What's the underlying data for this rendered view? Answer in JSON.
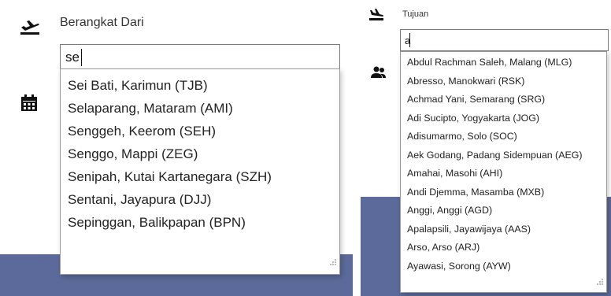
{
  "left": {
    "label": "Berangkat Dari",
    "input_value": "se",
    "icons": [
      "plane-departure-icon",
      "calendar-icon"
    ],
    "suggestions": [
      "Sei Bati, Karimun (TJB)",
      "Selaparang, Mataram (AMI)",
      "Senggeh, Keerom (SEH)",
      "Senggo, Mappi (ZEG)",
      "Senipah, Kutai Kartanegara (SZH)",
      "Sentani, Jayapura (DJJ)",
      "Sepinggan, Balikpapan (BPN)"
    ]
  },
  "right": {
    "label": "Tujuan",
    "input_value": "a",
    "icons": [
      "plane-arrival-icon",
      "users-icon"
    ],
    "suggestions": [
      "Abdul Rachman Saleh, Malang (MLG)",
      "Abresso, Manokwari (RSK)",
      "Achmad Yani, Semarang (SRG)",
      "Adi Sucipto, Yogyakarta (JOG)",
      "Adisumarmo, Solo (SOC)",
      "Aek Godang, Padang Sidempuan (AEG)",
      "Amahai, Masohi (AHI)",
      "Andi Djemma, Masamba (MXB)",
      "Anggi, Anggi (AGD)",
      "Apalapsili, Jayawijaya (AAS)",
      "Arso, Arso (ARJ)",
      "Ayawasi, Sorong (AYW)"
    ]
  },
  "colors": {
    "band": "#5b6a9a",
    "input_border": "#7a7a7a",
    "text": "#222222"
  }
}
